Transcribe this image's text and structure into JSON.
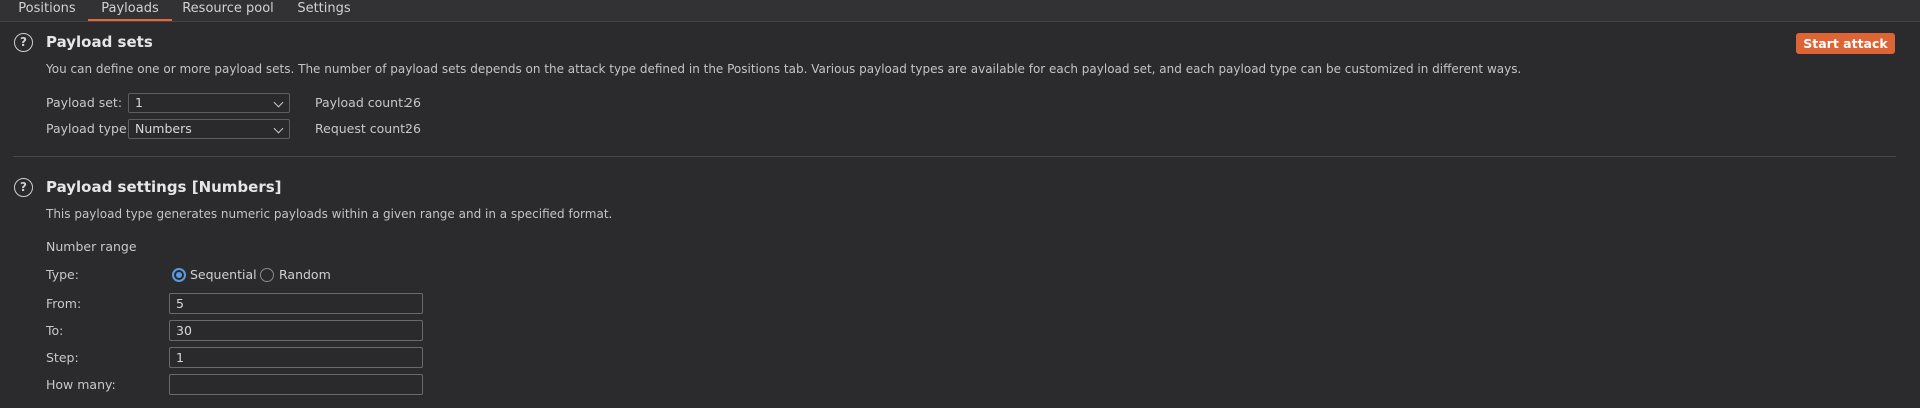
{
  "tabs": [
    {
      "label": "Positions"
    },
    {
      "label": "Payloads"
    },
    {
      "label": "Resource pool"
    },
    {
      "label": "Settings"
    }
  ],
  "active_tab": "Payloads",
  "accent_color": "#dd6434",
  "payload_sets": {
    "title": "Payload sets",
    "description": "You can define one or more payload sets. The number of payload sets depends on the attack type defined in the Positions tab. Various payload types are available for each payload set, and each payload type can be customized in different ways.",
    "start_attack_label": "Start attack",
    "payload_set_label": "Payload set:",
    "payload_set_value": "1",
    "payload_type_label": "Payload type:",
    "payload_type_value": "Numbers",
    "payload_count_label": "Payload count:",
    "payload_count_value": "26",
    "request_count_label": "Request count:",
    "request_count_value": "26"
  },
  "payload_settings": {
    "title": "Payload settings [Numbers]",
    "description": "This payload type generates numeric payloads within a given range and in a specified format.",
    "number_range_label": "Number range",
    "type_label": "Type:",
    "type_options": [
      "Sequential",
      "Random"
    ],
    "type_selected": "Sequential",
    "from_label": "From:",
    "from_value": "5",
    "to_label": "To:",
    "to_value": "30",
    "step_label": "Step:",
    "step_value": "1",
    "how_many_label": "How many:",
    "how_many_value": ""
  },
  "icons": [
    "help-icon",
    "chevron-down-icon"
  ]
}
